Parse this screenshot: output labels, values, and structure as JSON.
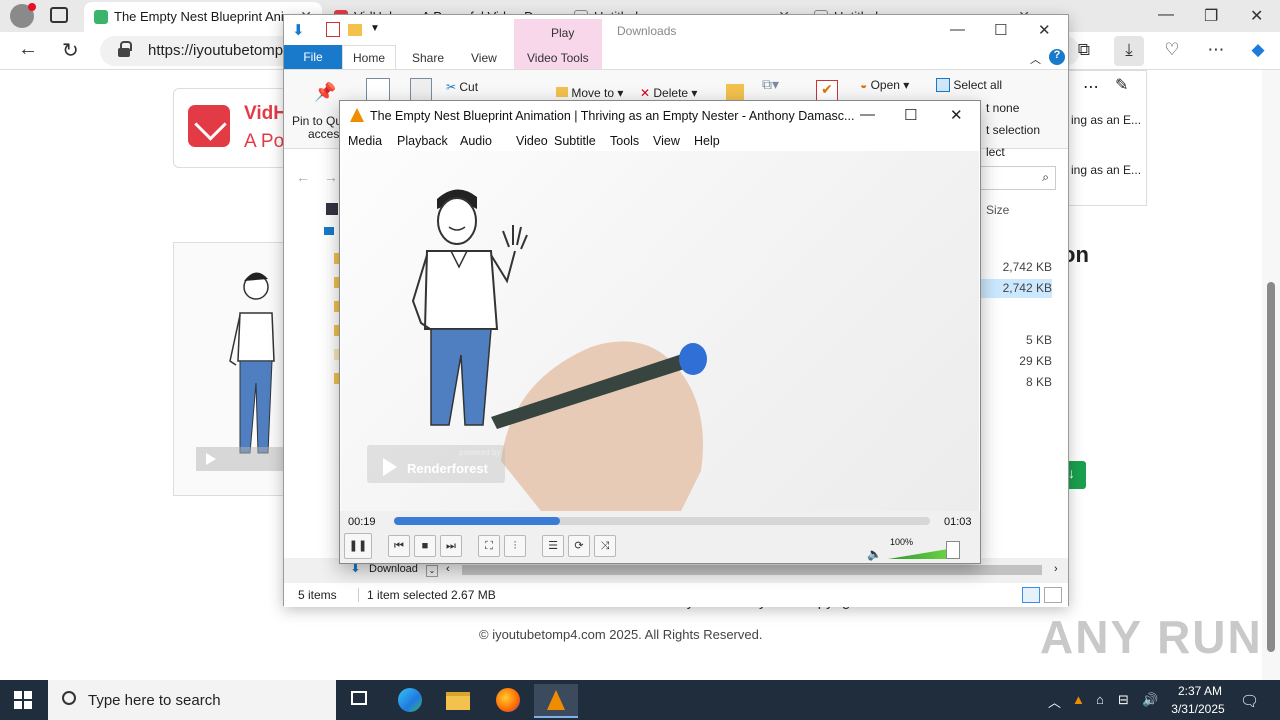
{
  "browser": {
    "tabs": [
      {
        "title": "The Empty Nest Blueprint Anim"
      },
      {
        "title": "VidHelper - A Powerful Video D"
      },
      {
        "title": "Untitled"
      },
      {
        "title": "Untitled"
      }
    ],
    "url": "https://iyoutubetomp4",
    "page": {
      "logo_name": "VidH",
      "logo_sub": "A Po",
      "side_items": [
        "ing as an E...",
        "ing as an E..."
      ],
      "heading_fragment": "on",
      "footer_links": "Contact Terms of Use Privacy Policy Copyright Notice",
      "copyright": "© iyoutubetomp4.com 2025. All Rights Reserved."
    },
    "watermark": "ANY RUN"
  },
  "explorer": {
    "title": "Downloads",
    "contextual_tab": "Play",
    "tabs": {
      "file": "File",
      "home": "Home",
      "share": "Share",
      "view": "View",
      "video_tools": "Video Tools"
    },
    "ribbon": {
      "pin": "Pin to Qu",
      "pin2": "access",
      "cut": "Cut",
      "move_to": "Move to",
      "delete": "Delete",
      "open": "Open",
      "select_all": "Select all",
      "select_none": "t none",
      "invert": "t selection",
      "select": "lect"
    },
    "column_size": "Size",
    "sizes": [
      "2,742 KB",
      "2,742 KB",
      "5 KB",
      "29 KB",
      "8 KB"
    ],
    "download_bar": "Download",
    "status": {
      "items": "5 items",
      "selected": "1 item selected  2.67 MB"
    }
  },
  "vlc": {
    "title": "The Empty Nest Blueprint Animation  |  Thriving as an Empty Nester - Anthony Damasc...",
    "menu": [
      "Media",
      "Playback",
      "Audio",
      "Video",
      "Subtitle",
      "Tools",
      "View",
      "Help"
    ],
    "watermark_top": "powered by",
    "watermark_name": "Renderforest",
    "time_elapsed": "00:19",
    "time_total": "01:03",
    "progress": 0.31,
    "volume_label": "100%",
    "volume": 1.0
  },
  "taskbar": {
    "search_placeholder": "Type here to search",
    "time": "2:37 AM",
    "date": "3/31/2025"
  }
}
